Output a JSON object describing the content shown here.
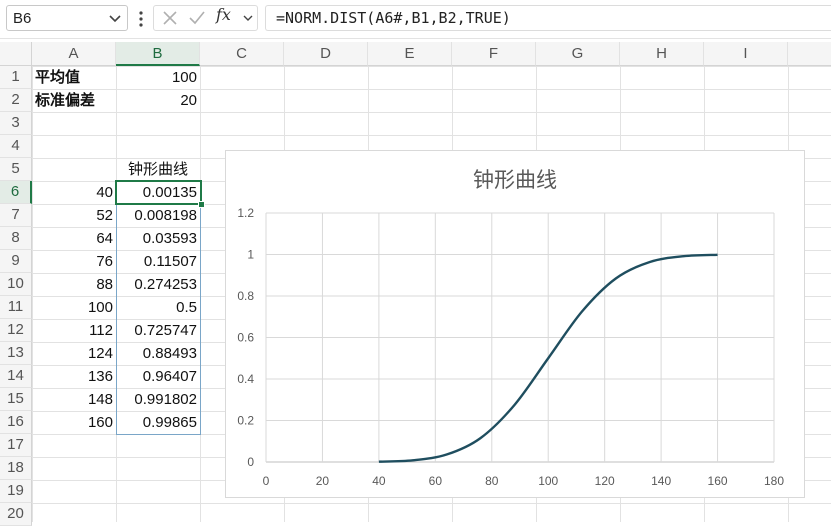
{
  "formula_bar": {
    "name_box": "B6",
    "fx_label": "fx",
    "formula": "=NORM.DIST(A6#,B1,B2,TRUE)"
  },
  "columns": [
    "A",
    "B",
    "C",
    "D",
    "E",
    "F",
    "G",
    "H",
    "I"
  ],
  "selected_column": "B",
  "rows": [
    "1",
    "2",
    "3",
    "4",
    "5",
    "6",
    "7",
    "8",
    "9",
    "10",
    "11",
    "12",
    "13",
    "14",
    "15",
    "16",
    "17",
    "18",
    "19",
    "20"
  ],
  "selected_row": "6",
  "cells": {
    "A1": "平均值",
    "B1": "100",
    "A2": "标准偏差",
    "B2": "20",
    "B5": "钟形曲线",
    "A6": "40",
    "B6": "0.00135",
    "A7": "52",
    "B7": "0.008198",
    "A8": "64",
    "B8": "0.03593",
    "A9": "76",
    "B9": "0.11507",
    "A10": "88",
    "B10": "0.274253",
    "A11": "100",
    "B11": "0.5",
    "A12": "112",
    "B12": "0.725747",
    "A13": "124",
    "B13": "0.88493",
    "A14": "136",
    "B14": "0.96407",
    "A15": "148",
    "B15": "0.991802",
    "A16": "160",
    "B16": "0.99865"
  },
  "colors": {
    "accent": "#1f7a47",
    "series": "#1f4e5f"
  },
  "chart_data": {
    "type": "line",
    "title": "钟形曲线",
    "x": [
      40,
      52,
      64,
      76,
      88,
      100,
      112,
      124,
      136,
      148,
      160
    ],
    "series": [
      {
        "values": [
          0.00135,
          0.008198,
          0.03593,
          0.11507,
          0.274253,
          0.5,
          0.725747,
          0.88493,
          0.96407,
          0.991802,
          0.99865
        ]
      }
    ],
    "xlim": [
      0,
      180
    ],
    "ylim": [
      0,
      1.2
    ],
    "xticks": [
      "0",
      "20",
      "40",
      "60",
      "80",
      "100",
      "120",
      "140",
      "160",
      "180"
    ],
    "yticks": [
      "0",
      "0.2",
      "0.4",
      "0.6",
      "0.8",
      "1",
      "1.2"
    ],
    "grid": true,
    "smooth": true
  }
}
